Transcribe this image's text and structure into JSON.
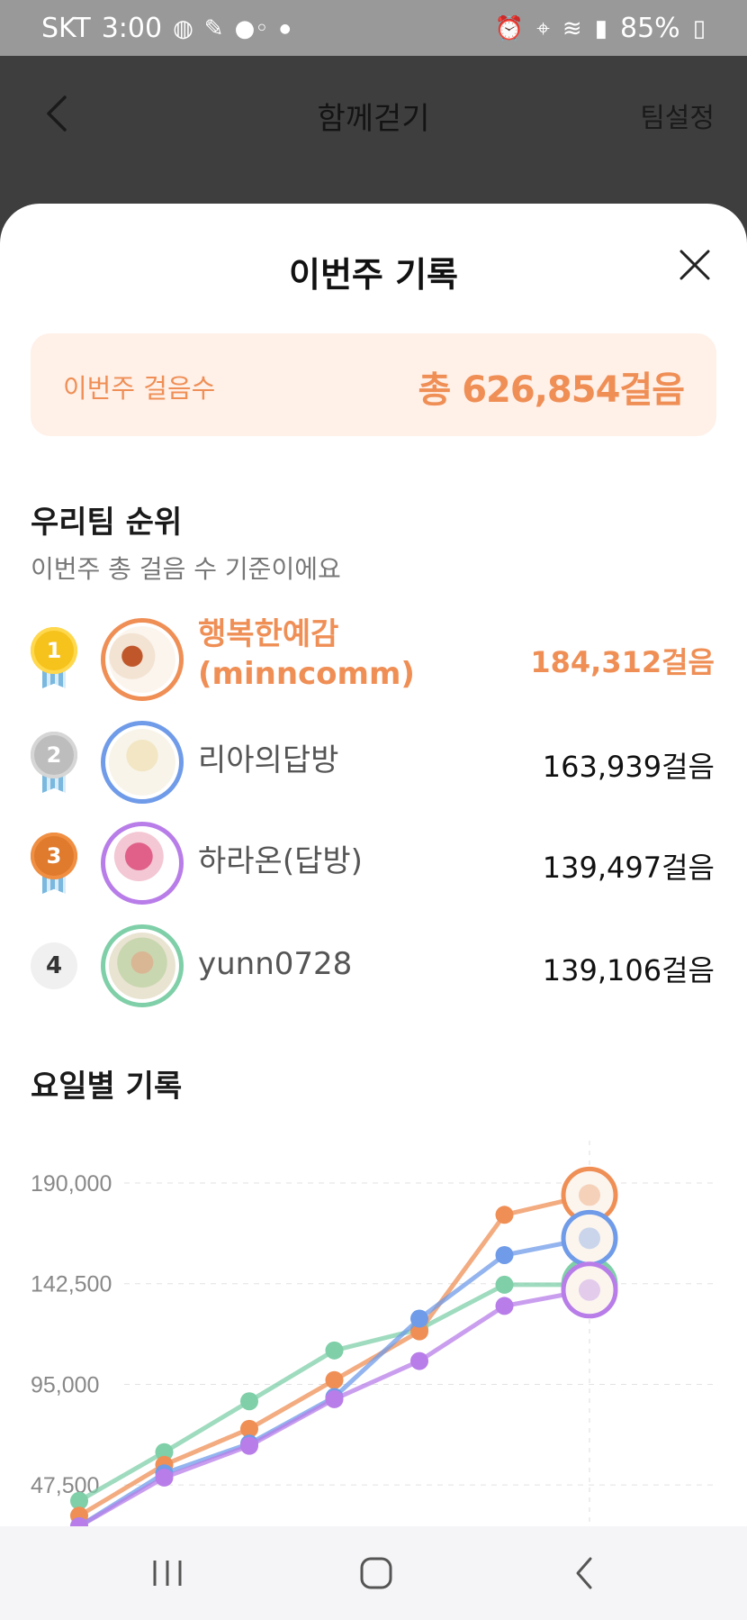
{
  "status_bar": {
    "carrier": "SKT",
    "time": "3:00",
    "battery": "85%",
    "icons": [
      "globe-icon",
      "notification-icon",
      "dots-icon",
      "alarm-icon",
      "location-icon",
      "wifi-icon",
      "signal-icon",
      "battery-icon"
    ]
  },
  "app_bar": {
    "title": "함께걷기",
    "team_settings": "팀설정"
  },
  "sheet": {
    "title": "이번주 기록",
    "total_label": "이번주 걸음수",
    "total_value": "총 626,854걸음"
  },
  "ranking": {
    "title": "우리팀 순위",
    "subtitle": "이번주 총 걸음 수 기준이에요",
    "rows": [
      {
        "rank": "1",
        "name_line1": "행복한예감",
        "name_line2": "(minncomm)",
        "steps": "184,312걸음",
        "color": "#ef8f56"
      },
      {
        "rank": "2",
        "name": "리아의답방",
        "steps": "163,939걸음",
        "color": "#6f9be8"
      },
      {
        "rank": "3",
        "name": "하라온(답방)",
        "steps": "139,497걸음",
        "color": "#b87de8"
      },
      {
        "rank": "4",
        "name": "yunn0728",
        "steps": "139,106걸음",
        "color": "#7fcfa8"
      }
    ]
  },
  "daily": {
    "title": "요일별 기록"
  },
  "chart_data": {
    "type": "line",
    "y_ticks": [
      "190,000",
      "142,500",
      "95,000",
      "47,500"
    ],
    "ylim": [
      28000,
      210000
    ],
    "x": [
      1,
      2,
      3,
      4,
      5,
      6,
      7
    ],
    "grid": true,
    "series": [
      {
        "color": "#7fcfa8",
        "values": [
          40000,
          63000,
          87000,
          111000,
          121000,
          142000,
          142000
        ]
      },
      {
        "color": "#ef8f56",
        "values": [
          33000,
          57000,
          74000,
          97000,
          120000,
          175000,
          184312
        ]
      },
      {
        "color": "#6f9be8",
        "values": [
          28000,
          53000,
          67000,
          89000,
          126000,
          156000,
          163939
        ]
      },
      {
        "color": "#b87de8",
        "values": [
          28000,
          51000,
          66000,
          88000,
          106000,
          132000,
          139497
        ]
      }
    ]
  },
  "nav_bar": {
    "icons": [
      "recents-icon",
      "home-icon",
      "back-icon"
    ]
  },
  "colors": {
    "accent": "#ef8f56",
    "accent_bg": "#fff0e8"
  }
}
